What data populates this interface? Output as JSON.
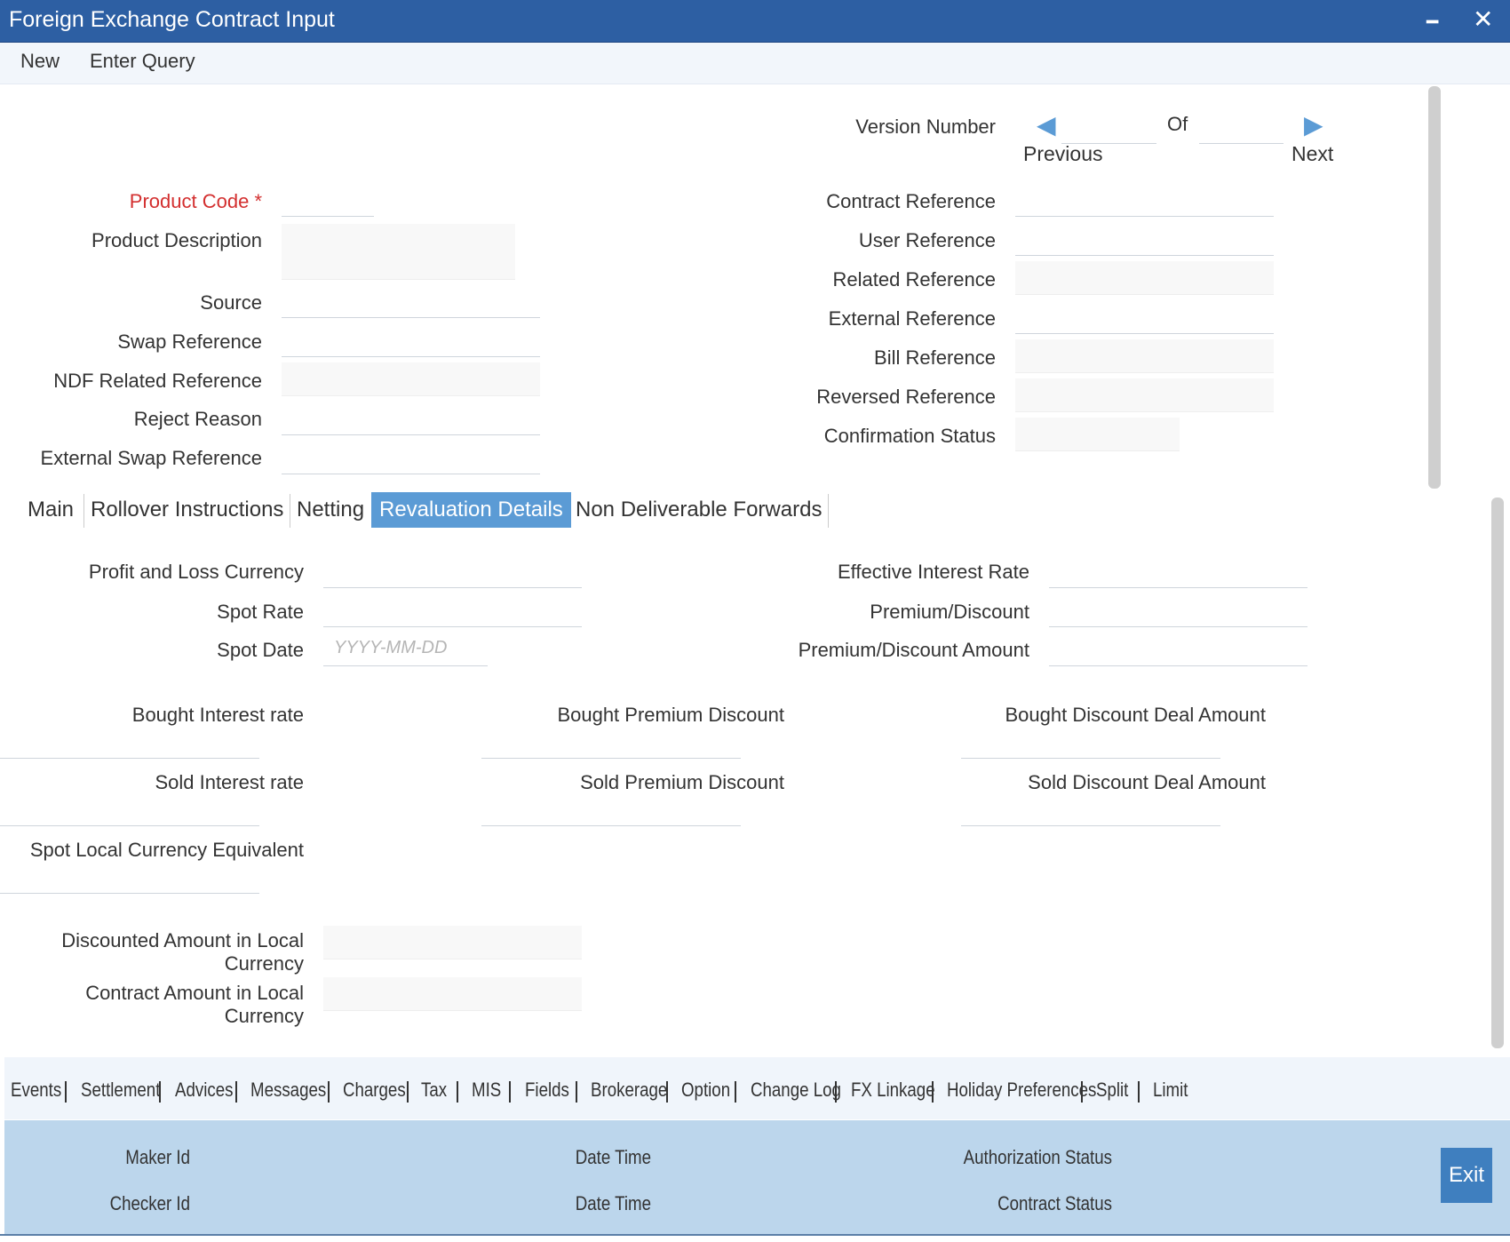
{
  "window": {
    "title": "Foreign Exchange Contract Input",
    "minimize_glyph": "━",
    "close_glyph": "✕",
    "accent_color": "#2d5fa3"
  },
  "menu": {
    "new": "New",
    "enter_query": "Enter Query"
  },
  "header": {
    "version_number": "Version Number",
    "of": "Of",
    "previous": "Previous",
    "next": "Next",
    "prev_glyph": "◀",
    "next_glyph": "▶",
    "product_code": "Product Code",
    "required_marker": "*",
    "product_description": "Product Description",
    "source": "Source",
    "swap_reference": "Swap Reference",
    "ndf_related_reference": "NDF Related Reference",
    "reject_reason": "Reject Reason",
    "external_swap_reference": "External Swap Reference",
    "contract_reference": "Contract Reference",
    "user_reference": "User Reference",
    "related_reference": "Related Reference",
    "external_reference": "External Reference",
    "bill_reference": "Bill Reference",
    "reversed_reference": "Reversed Reference",
    "confirmation_status": "Confirmation Status"
  },
  "tabs": {
    "main": "Main",
    "rollover": "Rollover Instructions",
    "netting": "Netting",
    "revaluation": "Revaluation Details",
    "ndf": "Non Deliverable Forwards",
    "active_color": "#5b9bd5"
  },
  "revaluation": {
    "pnl_currency": "Profit and Loss Currency",
    "spot_rate": "Spot Rate",
    "spot_date": "Spot Date",
    "spot_date_placeholder": "YYYY-MM-DD",
    "effective_interest_rate": "Effective Interest Rate",
    "premium_discount": "Premium/Discount",
    "premium_discount_amount": "Premium/Discount Amount",
    "bought_interest_rate": "Bought Interest rate",
    "bought_premium_discount": "Bought Premium Discount",
    "bought_discount_deal_amount": "Bought Discount Deal Amount",
    "sold_interest_rate": "Sold Interest rate",
    "sold_premium_discount": "Sold Premium Discount",
    "sold_discount_deal_amount": "Sold Discount Deal Amount",
    "spot_lcy_equivalent": "Spot Local Currency Equivalent",
    "discounted_amount_lcy_1": "Discounted Amount in Local",
    "discounted_amount_lcy_2": "Currency",
    "contract_amount_lcy_1": "Contract Amount in Local",
    "contract_amount_lcy_2": "Currency"
  },
  "bottom_links": [
    "Events",
    "Settlement",
    "Advices",
    "Messages",
    "Charges",
    "Tax",
    "MIS",
    "Fields",
    "Brokerage",
    "Option",
    "Change Log",
    "FX Linkage",
    "Holiday Preferences",
    "Split",
    "Limit"
  ],
  "footer": {
    "maker_id": "Maker Id",
    "checker_id": "Checker Id",
    "date_time_1": "Date Time",
    "date_time_2": "Date Time",
    "authorization_status": "Authorization Status",
    "contract_status": "Contract Status",
    "exit": "Exit",
    "background_color": "#bcd6ec"
  }
}
